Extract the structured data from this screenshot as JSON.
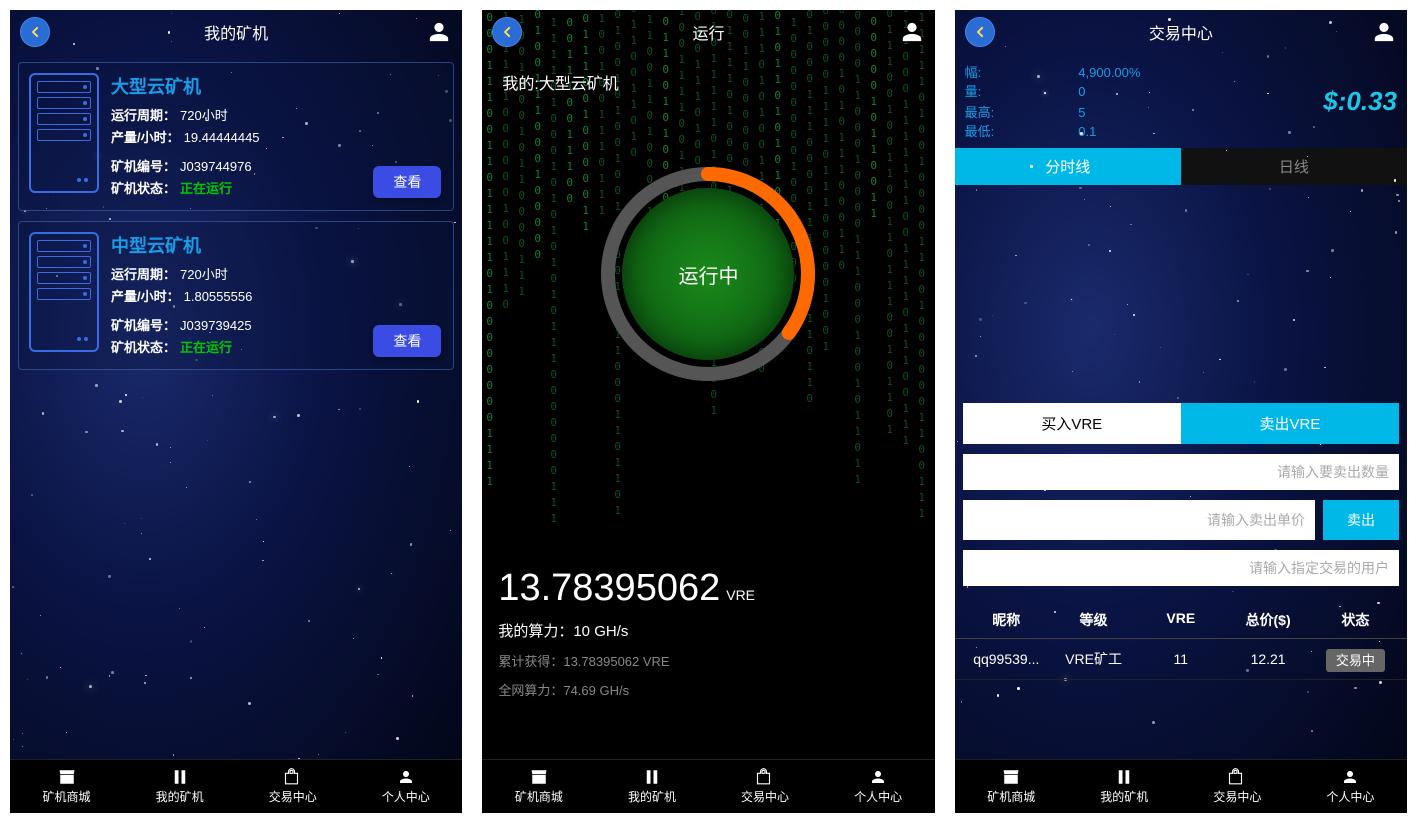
{
  "phone1": {
    "title": "我的矿机",
    "miners": [
      {
        "name": "大型云矿机",
        "cycle_label": "运行周期：",
        "cycle_value": "720小时",
        "yield_label": "产量/小时：",
        "yield_value": "19.44444445",
        "id_label": "矿机编号：",
        "id_value": "J039744976",
        "status_label": "矿机状态：",
        "status_value": "正在运行",
        "view": "查看"
      },
      {
        "name": "中型云矿机",
        "cycle_label": "运行周期：",
        "cycle_value": "720小时",
        "yield_label": "产量/小时：",
        "yield_value": "1.80555556",
        "id_label": "矿机编号：",
        "id_value": "J039739425",
        "status_label": "矿机状态：",
        "status_value": "正在运行",
        "view": "查看"
      }
    ]
  },
  "phone2": {
    "title": "运行",
    "my_label": "我的:大型云矿机",
    "center": "运行中",
    "big_number": "13.78395062",
    "unit": "VRE",
    "hash_label": "我的算力：",
    "hash_value": "10 GH/s",
    "total_label": "累计获得：",
    "total_value": "13.78395062 VRE",
    "net_label": "全网算力：",
    "net_value": "74.69 GH/s"
  },
  "phone3": {
    "title": "交易中心",
    "change_label": "幅:",
    "change_value": "4,900.00%",
    "vol_label": "量:",
    "vol_value": "0",
    "high_label": "最高:",
    "high_value": "5",
    "low_label": "最低:",
    "low_value": "0.1",
    "price": "$:0.33",
    "tab1": "分时线",
    "tab2": "日线",
    "buy_btn": "买入VRE",
    "sell_btn": "卖出VRE",
    "qty_placeholder": "请输入要卖出数量",
    "price_placeholder": "请输入卖出单价",
    "user_placeholder": "请输入指定交易的用户",
    "submit": "卖出",
    "headers": {
      "nick": "昵称",
      "level": "等级",
      "vre": "VRE",
      "total": "总价($)",
      "status": "状态"
    },
    "rows": [
      {
        "nick": "qq99539...",
        "level": "VRE矿工",
        "vre": "11",
        "total": "12.21",
        "status": "交易中"
      }
    ]
  },
  "nav": {
    "shop": "矿机商城",
    "mine": "我的矿机",
    "trade": "交易中心",
    "me": "个人中心"
  }
}
